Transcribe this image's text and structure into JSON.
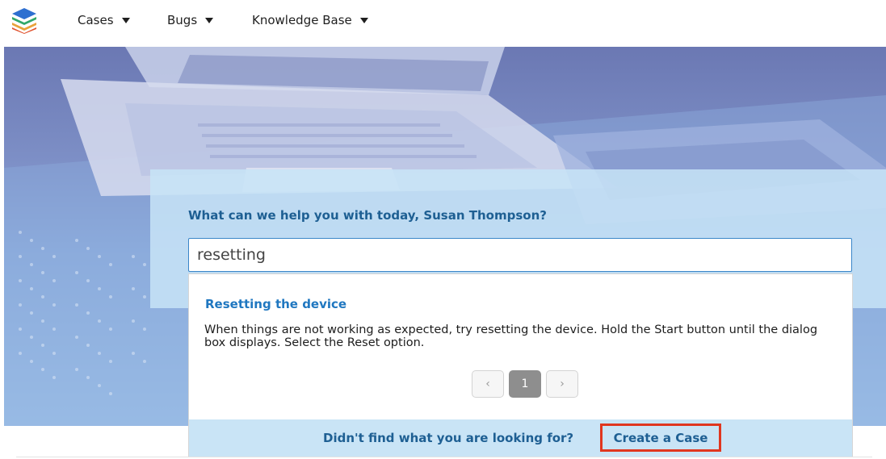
{
  "nav": {
    "items": [
      {
        "label": "Cases"
      },
      {
        "label": "Bugs"
      },
      {
        "label": "Knowledge Base"
      }
    ]
  },
  "search": {
    "greeting": "What can we help you with today, Susan Thompson?",
    "value": "resetting"
  },
  "results": [
    {
      "title": "Resetting the device",
      "body": "When things are not working as expected, try resetting the device. Hold the Start button until the dialog box displays. Select the Reset option."
    }
  ],
  "pagination": {
    "current_page": "1"
  },
  "footer": {
    "prompt": "Didn't find what you are looking for?",
    "create_case_label": "Create a Case"
  },
  "colors": {
    "accent": "#1f77c0",
    "heading": "#1e5f93",
    "highlight_border": "#e0361f"
  }
}
